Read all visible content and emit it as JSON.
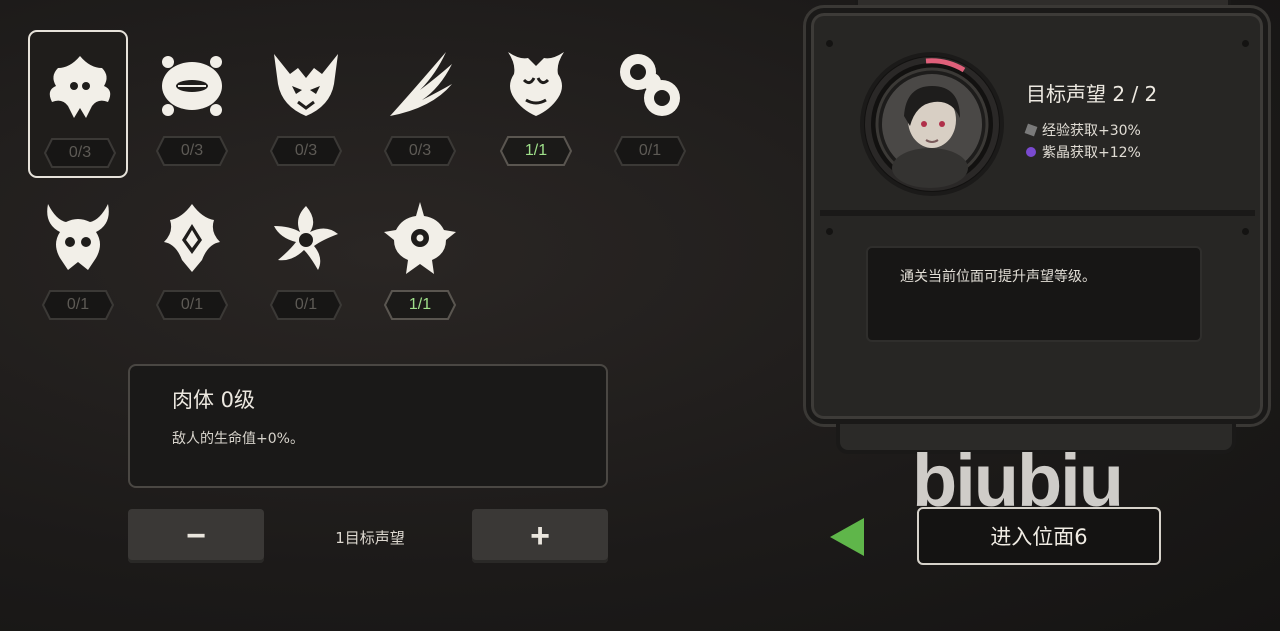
{
  "modifiers": [
    {
      "name": "crab-beast-icon",
      "level": "0/3",
      "done": false,
      "selected": true
    },
    {
      "name": "blob-creature-icon",
      "level": "0/3",
      "done": false,
      "selected": false
    },
    {
      "name": "horned-demon-icon",
      "level": "0/3",
      "done": false,
      "selected": false
    },
    {
      "name": "claw-slash-icon",
      "level": "0/3",
      "done": false,
      "selected": false
    },
    {
      "name": "flame-mask-icon",
      "level": "1/1",
      "done": true,
      "selected": false
    },
    {
      "name": "orb-cluster-icon",
      "level": "0/1",
      "done": false,
      "selected": false
    },
    {
      "name": "horned-skull-icon",
      "level": "0/1",
      "done": false,
      "selected": false
    },
    {
      "name": "crest-emblem-icon",
      "level": "0/1",
      "done": false,
      "selected": false
    },
    {
      "name": "spiral-star-icon",
      "level": "0/1",
      "done": false,
      "selected": false
    },
    {
      "name": "spiked-eye-icon",
      "level": "1/1",
      "done": true,
      "selected": false
    }
  ],
  "detail": {
    "title": "肉体 0级",
    "description": "敌人的生命值+0%。"
  },
  "controls": {
    "minus_label": "−",
    "plus_label": "+",
    "cost_label": "1目标声望"
  },
  "reputation": {
    "title": "目标声望 2 / 2",
    "bonuses": [
      {
        "text": "经验获取+30%",
        "color": "#7a7a7a"
      },
      {
        "text": "紫晶获取+12%",
        "color": "#7a4ad0"
      }
    ],
    "hint": "通关当前位面可提升声望等级。"
  },
  "enter_button": "进入位面6",
  "watermark": "biubiu",
  "colors": {
    "accent_green": "#5fb64a",
    "done_text": "#9fe08a",
    "portrait_ring_accent": "#e0607a"
  }
}
